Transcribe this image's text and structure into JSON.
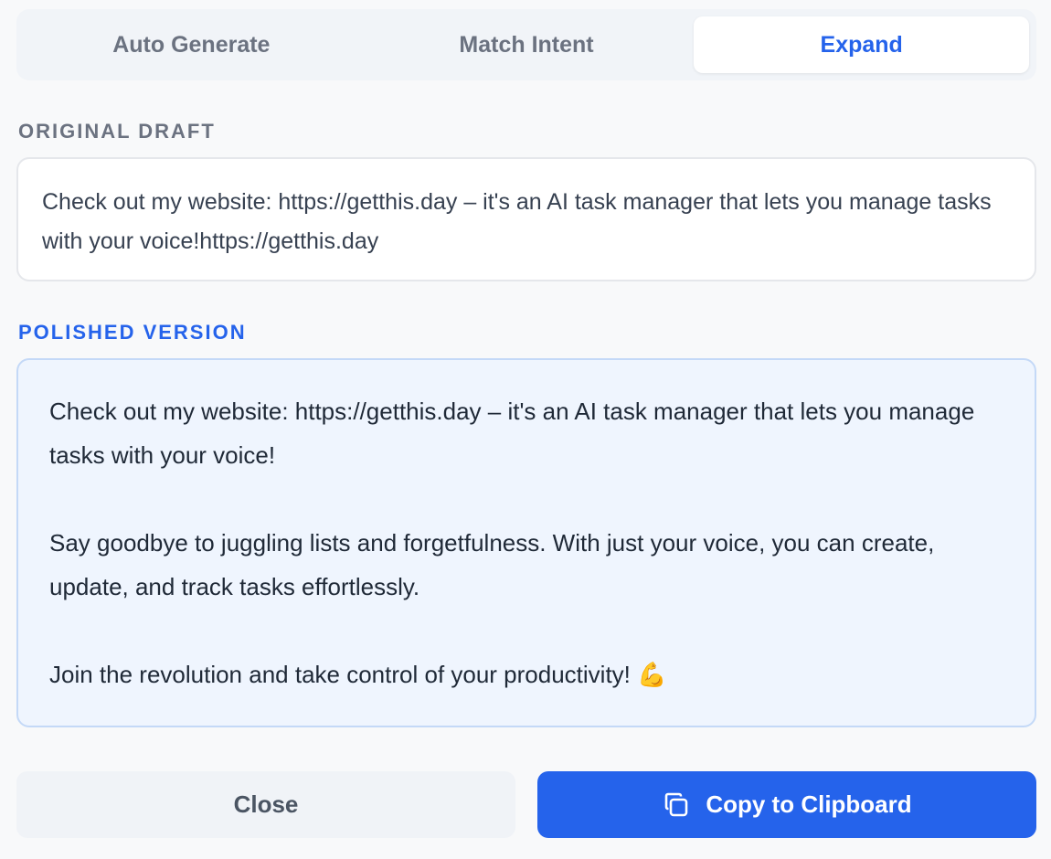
{
  "tabs": [
    {
      "label": "Auto Generate",
      "active": false
    },
    {
      "label": "Match Intent",
      "active": false
    },
    {
      "label": "Expand",
      "active": true
    }
  ],
  "original": {
    "label": "ORIGINAL DRAFT",
    "text": "Check out my website: https://getthis.day – it's an AI task manager that lets you manage tasks with your voice!https://getthis.day"
  },
  "polished": {
    "label": "POLISHED VERSION",
    "paragraphs": [
      "Check out my website: https://getthis.day – it's an AI task manager that lets you manage tasks with your voice!",
      "Say goodbye to juggling lists and forgetfulness. With just your voice, you can create, update, and track tasks effortlessly.",
      "Join the revolution and take control of your productivity! 💪"
    ]
  },
  "buttons": {
    "close_label": "Close",
    "copy_label": "Copy to Clipboard",
    "copy_icon": "copy-icon"
  },
  "colors": {
    "accent": "#2563eb",
    "background": "#f8f9fa",
    "polished_bg": "#eff5fe"
  }
}
